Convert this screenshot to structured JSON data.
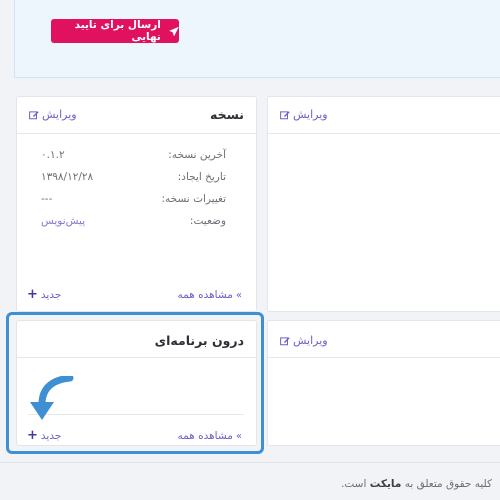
{
  "top": {
    "submit_label": "ارسال برای تایید نهایی"
  },
  "version_card": {
    "title": "نسخه",
    "edit_label": "ویرایش",
    "rows": [
      {
        "label": "آخرین نسخه:",
        "value": "۰.۱.۲"
      },
      {
        "label": "تاریخ ایجاد:",
        "value": "۱۳۹۸/۱۲/۲۸"
      },
      {
        "label": "تغییرات نسخه:",
        "value": "---"
      },
      {
        "label": "وضعیت:",
        "value": "پیش‌نویس"
      }
    ],
    "view_all_label": "مشاهده همه",
    "new_label": "جدید"
  },
  "right_card_top": {
    "edit_label": "ویرایش"
  },
  "inapp_card": {
    "title": "درون برنامه‌ای",
    "view_all_label": "مشاهده همه",
    "new_label": "جدید"
  },
  "right_card_bottom": {
    "edit_label": "ویرایش"
  },
  "footer": {
    "copyright_prefix": "کلیه حقوق متعلق به",
    "brand": "مایکت",
    "copyright_suffix": "است."
  },
  "colors": {
    "accent": "#e0115f",
    "link": "#6f5ec8",
    "highlight": "#3f8fd3"
  }
}
